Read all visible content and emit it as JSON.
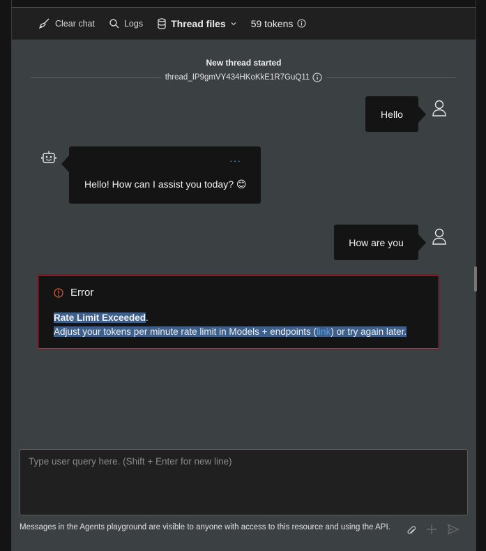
{
  "toolbar": {
    "clear_chat": "Clear chat",
    "logs": "Logs",
    "thread_files": "Thread files",
    "tokens": "59 tokens"
  },
  "thread": {
    "title": "New thread started",
    "id": "thread_IP9gmVY434HKoKkE1R7GuQ11"
  },
  "messages": [
    {
      "role": "user",
      "text": "Hello"
    },
    {
      "role": "assistant",
      "text": "Hello! How can I assist you today? 😊",
      "more": "···"
    },
    {
      "role": "user",
      "text": "How are you"
    }
  ],
  "error": {
    "title": "Error",
    "headline": "Rate Limit Exceeded",
    "headline_punct": ".",
    "body_before": "Adjust your tokens per minute rate limit in Models + endpoints (",
    "link": "link",
    "body_after": ") or try again later."
  },
  "input": {
    "placeholder": "Type user query here. (Shift + Enter for new line)",
    "value": ""
  },
  "footer": {
    "note": "Messages in the Agents playground are visible to anyone with access to this resource and using the API."
  },
  "icons": {
    "clear": "broom-icon",
    "logs": "search-icon",
    "files": "database-icon",
    "info": "info-icon",
    "user": "person-icon",
    "bot": "bot-icon",
    "error": "error-circle-icon",
    "attach": "paperclip-icon",
    "add": "plus-icon",
    "send": "send-icon"
  },
  "colors": {
    "panel": "#3b4043",
    "bubble": "#141414",
    "error_border": "#b23a4a",
    "link": "#4ea0f0",
    "selection": "#3e5f8a"
  }
}
